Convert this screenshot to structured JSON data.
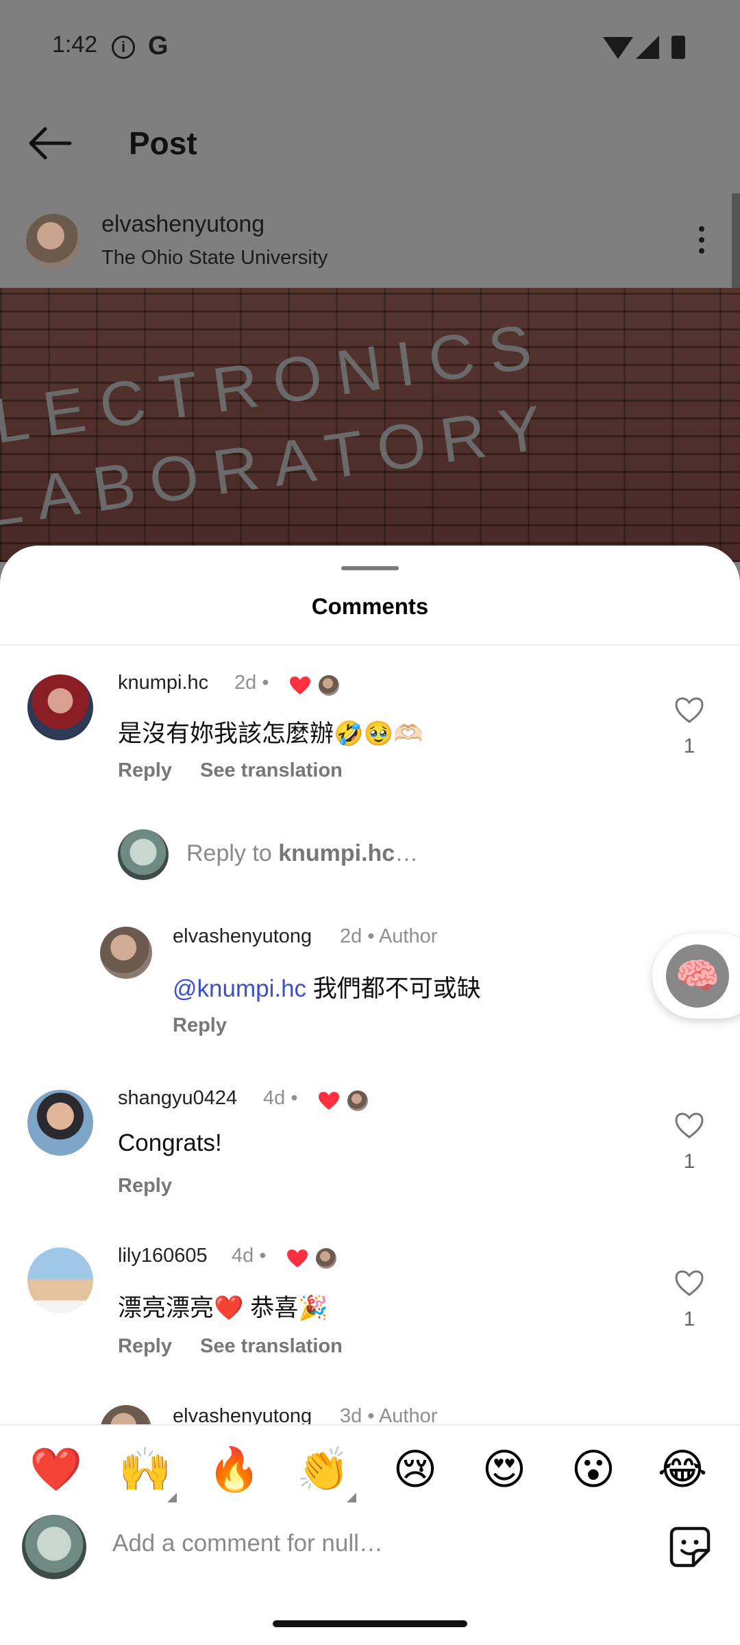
{
  "status_bar": {
    "time": "1:42"
  },
  "topbar": {
    "title": "Post"
  },
  "post": {
    "username": "elvashenyutong",
    "location": "The Ohio State University",
    "image_text_line1": "LECTRONICS",
    "image_text_line2": "LABORATORY"
  },
  "comments_sheet": {
    "title": "Comments",
    "comments": [
      {
        "username": "knumpi.hc",
        "time": "2d",
        "text": "是沒有妳我該怎麼辦🤣🥹🫶🏻",
        "reply_label": "Reply",
        "translate_label": "See translation",
        "likes": "1"
      },
      {
        "username": "shangyu0424",
        "time": "4d",
        "text": "Congrats!",
        "reply_label": "Reply",
        "likes": "1"
      },
      {
        "username": "lily160605",
        "time": "4d",
        "text": "漂亮漂亮❤️ 恭喜🎉",
        "reply_label": "Reply",
        "translate_label": "See translation",
        "likes": "1"
      }
    ],
    "reply_box": {
      "prefix": "Reply to ",
      "target": "knumpi.hc",
      "suffix": "…"
    },
    "author_reply": {
      "username": "elvashenyutong",
      "time": "2d",
      "badge": "Author",
      "mention": "@knumpi.hc",
      "text": " 我們都不可或缺",
      "reply_label": "Reply"
    },
    "author_reply_2": {
      "username": "elvashenyutong",
      "time": "3d",
      "badge": "Author"
    }
  },
  "composer": {
    "emojis": [
      "❤️",
      "🙌",
      "🔥",
      "👏",
      "😢",
      "😍",
      "😮",
      "😂"
    ],
    "placeholder": "Add a comment for null…"
  },
  "colors": {
    "like_red": "#ff3040",
    "mention_blue": "#3a4ecf"
  }
}
